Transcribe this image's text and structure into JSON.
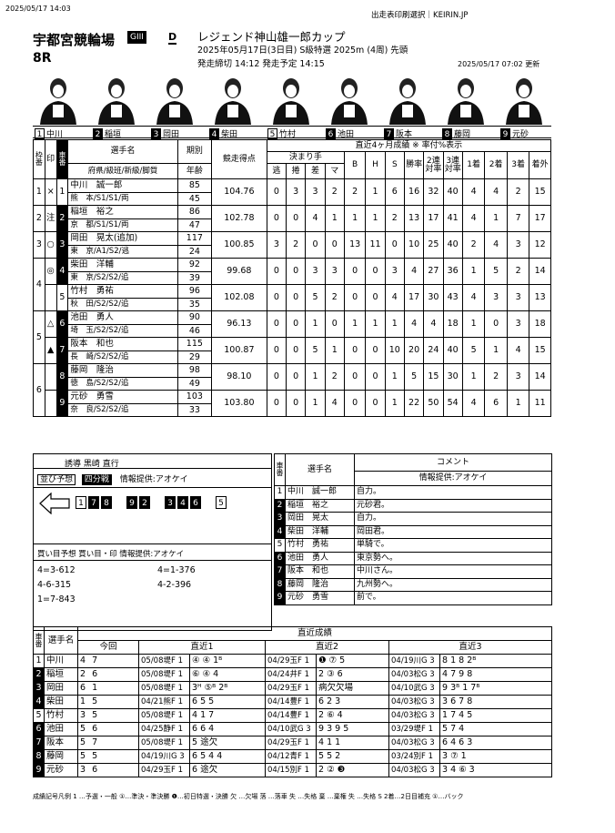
{
  "top_left": "2025/05/17 14:03",
  "top_center": "出走表印刷選択｜KEIRIN.JP",
  "venue": "宇都宮競輪場",
  "grade": "GIII",
  "grade_marker": "D",
  "race_title": "レジェンド神山雄一郎カップ",
  "race_info": "2025年05月17日(3日目) S級特選 2025m (4周) 先頭",
  "race_times": "発走締切 14:12 発走予定 14:15",
  "race_no": "8R",
  "updated": "2025/05/17 07:02 更新",
  "photo_labels": [
    {
      "no": "1",
      "name": "中川",
      "inv": false
    },
    {
      "no": "2",
      "name": "稲垣",
      "inv": true
    },
    {
      "no": "3",
      "name": "岡田",
      "inv": true
    },
    {
      "no": "4",
      "name": "柴田",
      "inv": true
    },
    {
      "no": "5",
      "name": "竹村",
      "inv": false
    },
    {
      "no": "6",
      "name": "池田",
      "inv": true
    },
    {
      "no": "7",
      "name": "阪本",
      "inv": true
    },
    {
      "no": "8",
      "name": "藤岡",
      "inv": true
    },
    {
      "no": "9",
      "name": "元砂",
      "inv": true
    }
  ],
  "main_headers": {
    "waku": "枠番",
    "mark": "印",
    "car": "車番",
    "player": "選手名",
    "pref": "府県/級班/新級/脚質",
    "period": "期別",
    "age": "年齢",
    "score": "競走得点",
    "recent": "直近4ヶ月成績 ※ 率付%表示",
    "kimarite": "決まり手",
    "nige": "逃",
    "makuri": "捲",
    "sashi": "差",
    "ma": "マ",
    "b": "B",
    "h": "H",
    "s": "S",
    "win": "勝率",
    "r2": "2連対率",
    "r3": "3連対率",
    "f1": "1着",
    "f2": "2着",
    "f3": "3着",
    "out": "着外"
  },
  "riders": [
    {
      "waku": "1",
      "mark": "×",
      "car": "1",
      "name": "中川　誠一郎",
      "pref": "熊　本/S1/S1/両",
      "period": "85",
      "age": "45",
      "score": "104.76",
      "k": [
        "0",
        "3",
        "3",
        "2"
      ],
      "b": "2",
      "h": "1",
      "s": "6",
      "win": "16",
      "r2": "32",
      "r3": "40",
      "f1": "4",
      "f2": "4",
      "f3": "2",
      "out": "15"
    },
    {
      "waku": "2",
      "mark": "注",
      "car": "2",
      "name": "稲垣　裕之",
      "pref": "京　都/S1/S1/両",
      "period": "86",
      "age": "47",
      "score": "102.78",
      "k": [
        "0",
        "0",
        "4",
        "1"
      ],
      "b": "1",
      "h": "1",
      "s": "2",
      "win": "13",
      "r2": "17",
      "r3": "41",
      "f1": "4",
      "f2": "1",
      "f3": "7",
      "out": "17"
    },
    {
      "waku": "3",
      "mark": "○",
      "car": "3",
      "name": "岡田　晃太(追加)",
      "pref": "東　京/A1/S2/逃",
      "period": "117",
      "age": "24",
      "score": "100.85",
      "k": [
        "3",
        "2",
        "0",
        "0"
      ],
      "b": "13",
      "h": "11",
      "s": "0",
      "win": "10",
      "r2": "25",
      "r3": "40",
      "f1": "2",
      "f2": "4",
      "f3": "3",
      "out": "12"
    },
    {
      "waku": "",
      "mark": "◎",
      "car": "4",
      "name": "柴田　洋輔",
      "pref": "東　京/S2/S2/追",
      "period": "92",
      "age": "39",
      "score": "99.68",
      "k": [
        "0",
        "0",
        "3",
        "3"
      ],
      "b": "0",
      "h": "0",
      "s": "3",
      "win": "4",
      "r2": "27",
      "r3": "36",
      "f1": "1",
      "f2": "5",
      "f3": "2",
      "out": "14"
    },
    {
      "waku": "4",
      "mark": "",
      "car": "5",
      "name": "竹村　勇祐",
      "pref": "秋　田/S2/S2/追",
      "period": "96",
      "age": "35",
      "score": "102.08",
      "k": [
        "0",
        "0",
        "5",
        "2"
      ],
      "b": "0",
      "h": "0",
      "s": "4",
      "win": "17",
      "r2": "30",
      "r3": "43",
      "f1": "4",
      "f2": "3",
      "f3": "3",
      "out": "13"
    },
    {
      "waku": "",
      "mark": "△",
      "car": "6",
      "name": "池田　勇人",
      "pref": "埼　玉/S2/S2/追",
      "period": "90",
      "age": "46",
      "score": "96.13",
      "k": [
        "0",
        "0",
        "1",
        "0"
      ],
      "b": "1",
      "h": "1",
      "s": "1",
      "win": "4",
      "r2": "4",
      "r3": "18",
      "f1": "1",
      "f2": "0",
      "f3": "3",
      "out": "18"
    },
    {
      "waku": "5",
      "mark": "▲",
      "car": "7",
      "name": "阪本　和也",
      "pref": "長　崎/S2/S2/追",
      "period": "115",
      "age": "29",
      "score": "100.87",
      "k": [
        "0",
        "0",
        "5",
        "1"
      ],
      "b": "0",
      "h": "0",
      "s": "10",
      "win": "20",
      "r2": "24",
      "r3": "40",
      "f1": "5",
      "f2": "1",
      "f3": "4",
      "out": "15"
    },
    {
      "waku": "",
      "mark": "",
      "car": "8",
      "name": "藤岡　隆治",
      "pref": "徳　島/S2/S2/追",
      "period": "98",
      "age": "49",
      "score": "98.10",
      "k": [
        "0",
        "0",
        "1",
        "2"
      ],
      "b": "0",
      "h": "0",
      "s": "1",
      "win": "5",
      "r2": "15",
      "r3": "30",
      "f1": "1",
      "f2": "2",
      "f3": "3",
      "out": "14"
    },
    {
      "waku": "6",
      "mark": "",
      "car": "9",
      "name": "元砂　勇雪",
      "pref": "奈　良/S2/S2/追",
      "period": "103",
      "age": "33",
      "score": "103.80",
      "k": [
        "0",
        "0",
        "1",
        "4"
      ],
      "b": "0",
      "h": "0",
      "s": "1",
      "win": "22",
      "r2": "50",
      "r3": "54",
      "f1": "4",
      "f2": "6",
      "f3": "1",
      "out": "11"
    }
  ],
  "tactics": {
    "left": "誘導 黒崎 直行",
    "narabi_label": "並び予想",
    "narabi_tag": "四分戦",
    "provider": "情報提供:アオケイ",
    "line": [
      "1",
      "7",
      "8",
      "9",
      "2",
      "3",
      "4",
      "6",
      "5"
    ]
  },
  "bets": {
    "title": "買い目予想 買い目・印 情報提供:アオケイ",
    "items": [
      "4=3-612",
      "4=1-376",
      "4-6-315",
      "4-2-396",
      "1=7-843"
    ]
  },
  "comments": {
    "header_car": "車番",
    "header_name": "選手名",
    "header_comment": "コメント",
    "provider": "情報提供:アオケイ",
    "rows": [
      {
        "car": "1",
        "name": "中川　誠一郎",
        "comment": "自力。"
      },
      {
        "car": "2",
        "name": "稲垣　裕之",
        "comment": "元砂君。"
      },
      {
        "car": "3",
        "name": "岡田　晃太",
        "comment": "自力。"
      },
      {
        "car": "4",
        "name": "柴田　洋輔",
        "comment": "岡田君。"
      },
      {
        "car": "5",
        "name": "竹村　勇祐",
        "comment": "単騎で。"
      },
      {
        "car": "6",
        "name": "池田　勇人",
        "comment": "東京勢へ。"
      },
      {
        "car": "7",
        "name": "阪本　和也",
        "comment": "中川さん。"
      },
      {
        "car": "8",
        "name": "藤岡　隆治",
        "comment": "九州勢へ。"
      },
      {
        "car": "9",
        "name": "元砂　勇雪",
        "comment": "前で。"
      }
    ]
  },
  "recent": {
    "header": "直近成績",
    "col_car": "車番",
    "col_name": "選手名",
    "col_today": "今回",
    "col_r1": "直近1",
    "col_r2": "直近2",
    "col_r3": "直近3",
    "rows": [
      {
        "car": "1",
        "name": "中川",
        "today": "4  7",
        "r1d": "05/08堤F 1",
        "r1": "④ ④ 1ᴮ",
        "r2d": "04/29玉F 1",
        "r2": "❶ ⑦ 5",
        "r3d": "04/19川G 3",
        "r3": "8 1 8 2ᴮ"
      },
      {
        "car": "2",
        "name": "稲垣",
        "today": "2  6",
        "r1d": "05/08堤F 1",
        "r1": "⑥ ④ 4",
        "r2d": "04/24井F 1",
        "r2": "2 ③ 6",
        "r3d": "04/03松G 3",
        "r3": "4 7 9 8"
      },
      {
        "car": "3",
        "name": "岡田",
        "today": "6  1",
        "r1d": "05/08堤F 1",
        "r1": "3ᴴ ⑤ᴮ 2ᴮ",
        "r2d": "04/29玉F 1",
        "r2": "病欠欠場",
        "r3d": "04/10武G 3",
        "r3": "9 3ᴮ 1 7ᴮ"
      },
      {
        "car": "4",
        "name": "柴田",
        "today": "1  5",
        "r1d": "04/21熊F 1",
        "r1": "6 5 5",
        "r2d": "04/14豊F 1",
        "r2": "6 2 3",
        "r3d": "04/03松G 3",
        "r3": "3 6 7 8"
      },
      {
        "car": "5",
        "name": "竹村",
        "today": "3  5",
        "r1d": "05/08堤F 1",
        "r1": "4 1 7",
        "r2d": "04/14豊F 1",
        "r2": "2 ⑥ 4",
        "r3d": "04/03松G 3",
        "r3": "1 7 4 5"
      },
      {
        "car": "6",
        "name": "池田",
        "today": "5  6",
        "r1d": "04/25静F 1",
        "r1": "6 6 4",
        "r2d": "04/10武G 3",
        "r2": "9 3 9 5",
        "r3d": "03/29堤F 1",
        "r3": "5 7 4"
      },
      {
        "car": "7",
        "name": "阪本",
        "today": "5  7",
        "r1d": "05/08堤F 1",
        "r1": "5 途欠",
        "r2d": "04/29玉F 1",
        "r2": "4 1 1",
        "r3d": "04/03松G 3",
        "r3": "6 4 6 3"
      },
      {
        "car": "8",
        "name": "藤岡",
        "today": "5  5",
        "r1d": "04/19川G 3",
        "r1": "6 5 4 4",
        "r2d": "04/12青F 1",
        "r2": "5 5 2",
        "r3d": "03/24別F 1",
        "r3": "3 ⑦ 1"
      },
      {
        "car": "9",
        "name": "元砂",
        "today": "3  6",
        "r1d": "04/29玉F 1",
        "r1": "6 途欠",
        "r2d": "04/15別F 1",
        "r2": "2 ② ❸",
        "r3d": "04/03松G 3",
        "r3": "3 4 ⑥ 3"
      }
    ]
  },
  "legend": "成績記号凡例  1 …予選・一般  ①…準決・準決勝  ❶…初日特選・決勝  欠 …欠場  落 …落車  失 …失格  棄 …棄権  失 …失格  S 2着…2日目補充  ①…バック"
}
